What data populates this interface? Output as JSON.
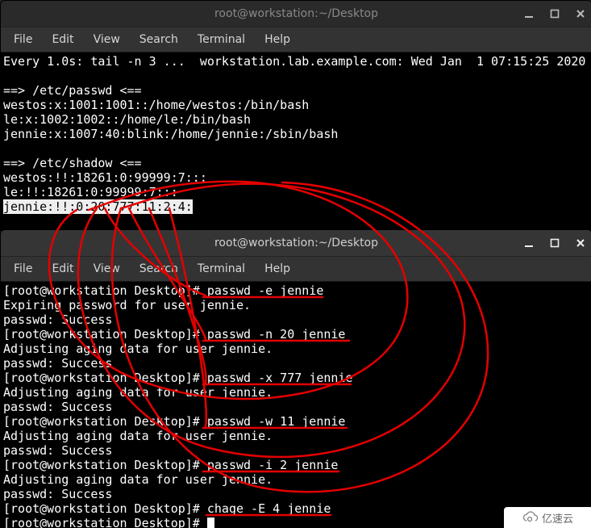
{
  "window1": {
    "title": "root@workstation:~/Desktop",
    "menubar": [
      "File",
      "Edit",
      "View",
      "Search",
      "Terminal",
      "Help"
    ],
    "lines": {
      "l0": "Every 1.0s: tail -n 3 ...  workstation.lab.example.com: Wed Jan  1 07:15:25 2020",
      "l1": "",
      "l2": "==> /etc/passwd <==",
      "l3": "westos:x:1001:1001::/home/westos:/bin/bash",
      "l4": "le:x:1002:1002::/home/le:/bin/bash",
      "l5": "jennie:x:1007:40:blink:/home/jennie:/sbin/bash",
      "l6": "",
      "l7": "==> /etc/shadow <==",
      "l8": "westos:!!:18261:0:99999:7:::",
      "l9": "le:!!:18261:0:99999:7:::",
      "l10": "jennie:!!:0:20:777:11:2:4:"
    }
  },
  "window2": {
    "title": "root@workstation:~/Desktop",
    "menubar": [
      "File",
      "Edit",
      "View",
      "Search",
      "Terminal",
      "Help"
    ],
    "prompt": "[root@workstation Desktop]# ",
    "lines": {
      "c0": "passwd -e jennie",
      "r0a": "Expiring password for user jennie.",
      "r0b": "passwd: Success",
      "c1": "passwd -n 20 jennie",
      "r1a": "Adjusting aging data for user jennie.",
      "r1b": "passwd: Success",
      "c2": "passwd -x 777 jennie",
      "r2a": "Adjusting aging data for user jennie.",
      "r2b": "passwd: Success",
      "c3": "passwd -w 11 jennie",
      "r3a": "Adjusting aging data for user jennie.",
      "r3b": "passwd: Success",
      "c4": "passwd -i 2 jennie",
      "r4a": "Adjusting aging data for user jennie.",
      "r4b": "passwd: Success",
      "c5": "chage -E 4 jennie"
    }
  },
  "watermark": "亿速云",
  "colors": {
    "annotation": "#e40000"
  }
}
